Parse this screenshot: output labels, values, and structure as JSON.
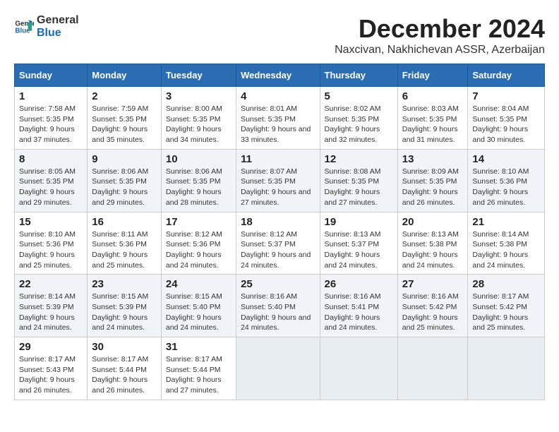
{
  "logo": {
    "text_general": "General",
    "text_blue": "Blue"
  },
  "title": "December 2024",
  "subtitle": "Naxcivan, Nakhichevan ASSR, Azerbaijan",
  "days_of_week": [
    "Sunday",
    "Monday",
    "Tuesday",
    "Wednesday",
    "Thursday",
    "Friday",
    "Saturday"
  ],
  "weeks": [
    [
      {
        "day": 1,
        "sunrise": "7:58 AM",
        "sunset": "5:35 PM",
        "daylight": "9 hours and 37 minutes."
      },
      {
        "day": 2,
        "sunrise": "7:59 AM",
        "sunset": "5:35 PM",
        "daylight": "9 hours and 35 minutes."
      },
      {
        "day": 3,
        "sunrise": "8:00 AM",
        "sunset": "5:35 PM",
        "daylight": "9 hours and 34 minutes."
      },
      {
        "day": 4,
        "sunrise": "8:01 AM",
        "sunset": "5:35 PM",
        "daylight": "9 hours and 33 minutes."
      },
      {
        "day": 5,
        "sunrise": "8:02 AM",
        "sunset": "5:35 PM",
        "daylight": "9 hours and 32 minutes."
      },
      {
        "day": 6,
        "sunrise": "8:03 AM",
        "sunset": "5:35 PM",
        "daylight": "9 hours and 31 minutes."
      },
      {
        "day": 7,
        "sunrise": "8:04 AM",
        "sunset": "5:35 PM",
        "daylight": "9 hours and 30 minutes."
      }
    ],
    [
      {
        "day": 8,
        "sunrise": "8:05 AM",
        "sunset": "5:35 PM",
        "daylight": "9 hours and 29 minutes."
      },
      {
        "day": 9,
        "sunrise": "8:06 AM",
        "sunset": "5:35 PM",
        "daylight": "9 hours and 29 minutes."
      },
      {
        "day": 10,
        "sunrise": "8:06 AM",
        "sunset": "5:35 PM",
        "daylight": "9 hours and 28 minutes."
      },
      {
        "day": 11,
        "sunrise": "8:07 AM",
        "sunset": "5:35 PM",
        "daylight": "9 hours and 27 minutes."
      },
      {
        "day": 12,
        "sunrise": "8:08 AM",
        "sunset": "5:35 PM",
        "daylight": "9 hours and 27 minutes."
      },
      {
        "day": 13,
        "sunrise": "8:09 AM",
        "sunset": "5:35 PM",
        "daylight": "9 hours and 26 minutes."
      },
      {
        "day": 14,
        "sunrise": "8:10 AM",
        "sunset": "5:36 PM",
        "daylight": "9 hours and 26 minutes."
      }
    ],
    [
      {
        "day": 15,
        "sunrise": "8:10 AM",
        "sunset": "5:36 PM",
        "daylight": "9 hours and 25 minutes."
      },
      {
        "day": 16,
        "sunrise": "8:11 AM",
        "sunset": "5:36 PM",
        "daylight": "9 hours and 25 minutes."
      },
      {
        "day": 17,
        "sunrise": "8:12 AM",
        "sunset": "5:36 PM",
        "daylight": "9 hours and 24 minutes."
      },
      {
        "day": 18,
        "sunrise": "8:12 AM",
        "sunset": "5:37 PM",
        "daylight": "9 hours and 24 minutes."
      },
      {
        "day": 19,
        "sunrise": "8:13 AM",
        "sunset": "5:37 PM",
        "daylight": "9 hours and 24 minutes."
      },
      {
        "day": 20,
        "sunrise": "8:13 AM",
        "sunset": "5:38 PM",
        "daylight": "9 hours and 24 minutes."
      },
      {
        "day": 21,
        "sunrise": "8:14 AM",
        "sunset": "5:38 PM",
        "daylight": "9 hours and 24 minutes."
      }
    ],
    [
      {
        "day": 22,
        "sunrise": "8:14 AM",
        "sunset": "5:39 PM",
        "daylight": "9 hours and 24 minutes."
      },
      {
        "day": 23,
        "sunrise": "8:15 AM",
        "sunset": "5:39 PM",
        "daylight": "9 hours and 24 minutes."
      },
      {
        "day": 24,
        "sunrise": "8:15 AM",
        "sunset": "5:40 PM",
        "daylight": "9 hours and 24 minutes."
      },
      {
        "day": 25,
        "sunrise": "8:16 AM",
        "sunset": "5:40 PM",
        "daylight": "9 hours and 24 minutes."
      },
      {
        "day": 26,
        "sunrise": "8:16 AM",
        "sunset": "5:41 PM",
        "daylight": "9 hours and 24 minutes."
      },
      {
        "day": 27,
        "sunrise": "8:16 AM",
        "sunset": "5:42 PM",
        "daylight": "9 hours and 25 minutes."
      },
      {
        "day": 28,
        "sunrise": "8:17 AM",
        "sunset": "5:42 PM",
        "daylight": "9 hours and 25 minutes."
      }
    ],
    [
      {
        "day": 29,
        "sunrise": "8:17 AM",
        "sunset": "5:43 PM",
        "daylight": "9 hours and 26 minutes."
      },
      {
        "day": 30,
        "sunrise": "8:17 AM",
        "sunset": "5:44 PM",
        "daylight": "9 hours and 26 minutes."
      },
      {
        "day": 31,
        "sunrise": "8:17 AM",
        "sunset": "5:44 PM",
        "daylight": "9 hours and 27 minutes."
      },
      null,
      null,
      null,
      null
    ]
  ]
}
